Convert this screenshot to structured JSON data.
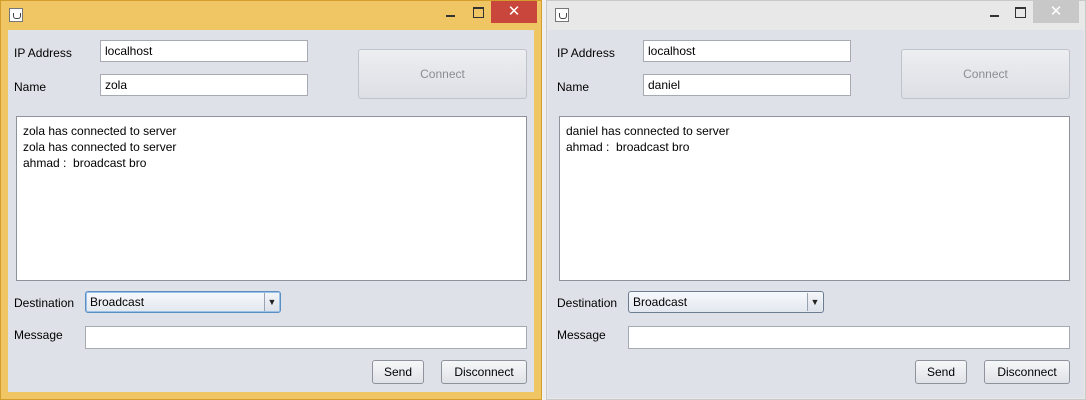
{
  "windows": [
    {
      "active": true,
      "labels": {
        "ip": "IP Address",
        "name": "Name",
        "destination": "Destination",
        "message": "Message"
      },
      "ip_value": "localhost",
      "name_value": "zola",
      "connect_label": "Connect",
      "log_lines": [
        "zola has connected to server",
        "zola has connected to server",
        "ahmad :  broadcast bro"
      ],
      "destination_value": "Broadcast",
      "message_value": "",
      "send_label": "Send",
      "disconnect_label": "Disconnect",
      "title_controls": {
        "minimize": "minimize-icon",
        "maximize": "maximize-icon",
        "close": "close-icon"
      }
    },
    {
      "active": false,
      "labels": {
        "ip": "IP Address",
        "name": "Name",
        "destination": "Destination",
        "message": "Message"
      },
      "ip_value": "localhost",
      "name_value": "daniel",
      "connect_label": "Connect",
      "log_lines": [
        "daniel has connected to server",
        "ahmad :  broadcast bro"
      ],
      "destination_value": "Broadcast",
      "message_value": "",
      "send_label": "Send",
      "disconnect_label": "Disconnect",
      "title_controls": {
        "minimize": "minimize-icon",
        "maximize": "maximize-icon",
        "close": "close-icon"
      }
    }
  ],
  "colors": {
    "active_frame": "#f0c564",
    "close_active": "#c9463d",
    "inactive_frame": "#e8e8e8",
    "client_bg": "#dee1e8"
  }
}
